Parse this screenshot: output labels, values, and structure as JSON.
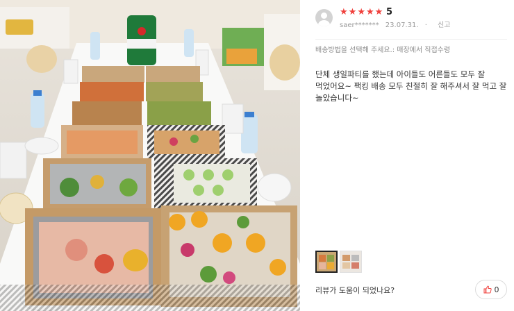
{
  "review": {
    "rating": "5",
    "rating_stars": 5,
    "star_color": "#f0413d",
    "author": "saer*******",
    "date": "23.07.31.",
    "report_label": "신고",
    "option_text": "배송방법을 선택해 주세요.: 매장에서 직접수령",
    "body": "단체 생일파티를 했는데 아이들도 어른들도 모두 잘 먹었어요~ 팩킹 배송 모두 친절히 잘 해주셔서 잘 먹고 잘 놀았습니다~",
    "thumbnails": [
      "review-photo-1",
      "review-photo-2"
    ],
    "selected_thumbnail": 1,
    "helpful_question": "리뷰가 도움이 되었나요?",
    "like_count": "0"
  },
  "photo": {
    "subject": "party-catering-food-trays",
    "can_brand": "Heineken"
  }
}
